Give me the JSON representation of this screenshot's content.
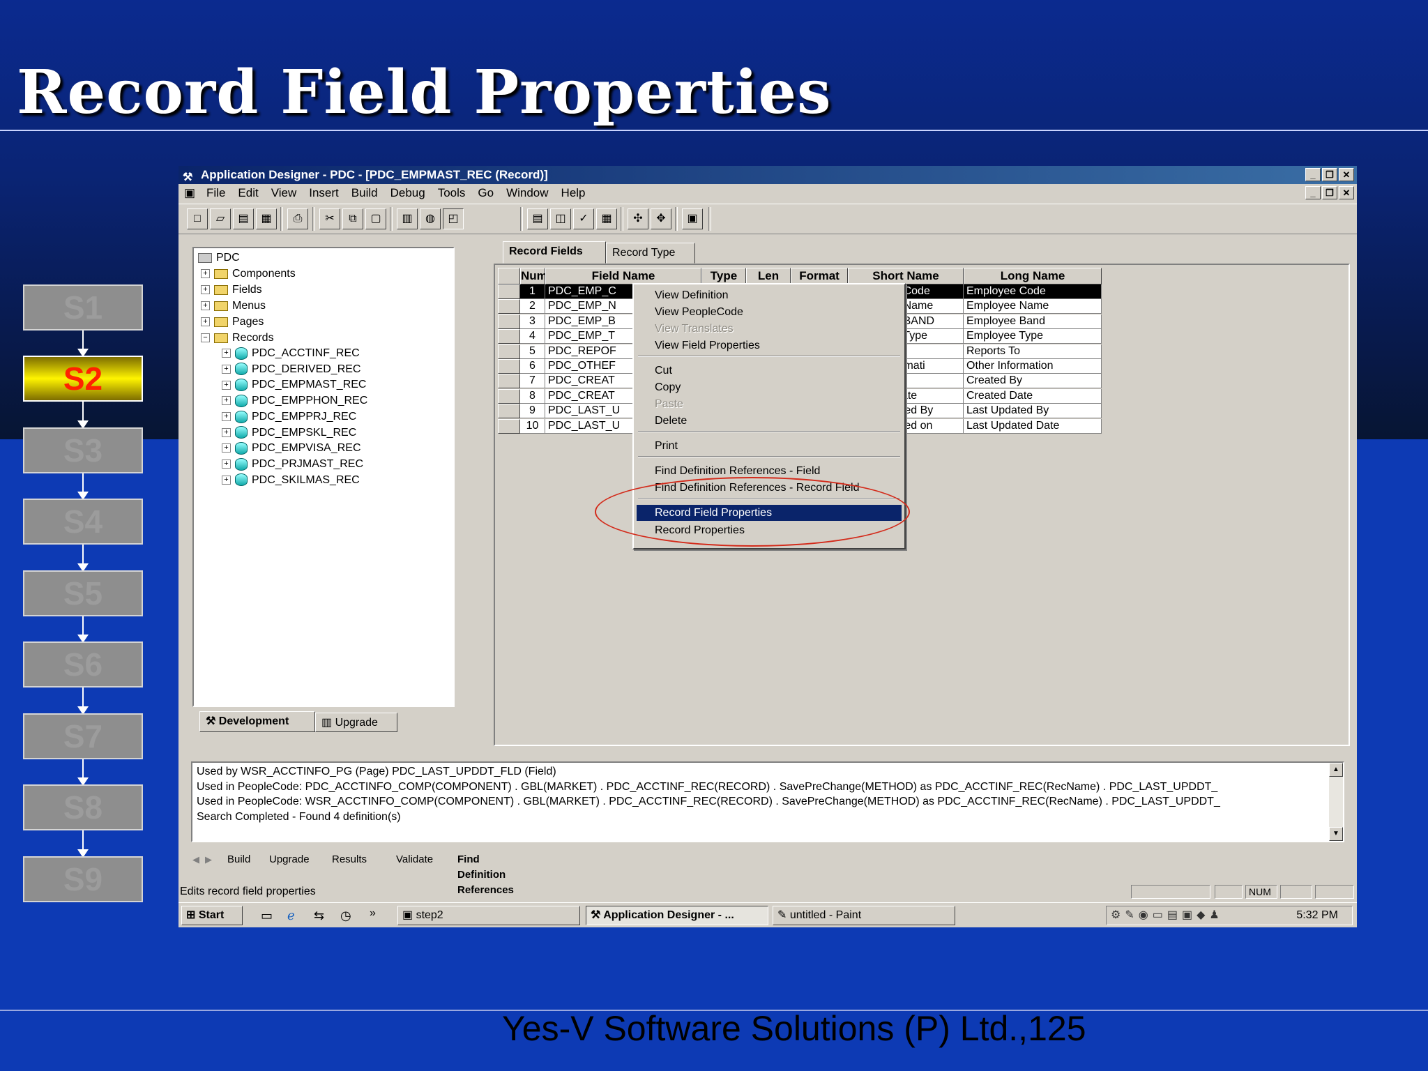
{
  "slide": {
    "title": "Record Field Properties",
    "footer": "Yes-V Software Solutions (P) Ltd.,125",
    "steps": [
      "S1",
      "S2",
      "S3",
      "S4",
      "S5",
      "S6",
      "S7",
      "S8",
      "S9"
    ],
    "active_step": "S2",
    "active_color": "#ff2200"
  },
  "window": {
    "title": "Application Designer - PDC - [PDC_EMPMAST_REC (Record)]",
    "menu": [
      "File",
      "Edit",
      "View",
      "Insert",
      "Build",
      "Debug",
      "Tools",
      "Go",
      "Window",
      "Help"
    ]
  },
  "tree": {
    "root": "PDC",
    "folders": [
      "Components",
      "Fields",
      "Menus",
      "Pages",
      "Records"
    ],
    "records": [
      "PDC_ACCTINF_REC",
      "PDC_DERIVED_REC",
      "PDC_EMPMAST_REC",
      "PDC_EMPPHON_REC",
      "PDC_EMPPRJ_REC",
      "PDC_EMPSKL_REC",
      "PDC_EMPVISA_REC",
      "PDC_PRJMAST_REC",
      "PDC_SKILMAS_REC"
    ],
    "tabs": [
      "Development",
      "Upgrade"
    ]
  },
  "record_tabs": [
    "Record Fields",
    "Record Type"
  ],
  "grid": {
    "headers": [
      "Num",
      "Field Name",
      "Type",
      "Len",
      "Format",
      "Short Name",
      "Long Name"
    ],
    "rows": [
      {
        "num": "1",
        "field": "PDC_EMP_C",
        "short": "Employee Code",
        "long": "Employee Code"
      },
      {
        "num": "2",
        "field": "PDC_EMP_N",
        "short": "Employee Name",
        "long": "Employee Name"
      },
      {
        "num": "3",
        "field": "PDC_EMP_B",
        "short": "Employee BAND",
        "long": "Employee Band"
      },
      {
        "num": "4",
        "field": "PDC_EMP_T",
        "short": "Employee Type",
        "long": "Employee Type"
      },
      {
        "num": "5",
        "field": "PDC_REPOF",
        "short": "Reports To",
        "long": "Reports To"
      },
      {
        "num": "6",
        "field": "PDC_OTHEF",
        "short": "Other Informati",
        "long": "Other Information"
      },
      {
        "num": "7",
        "field": "PDC_CREAT",
        "short": "Created By",
        "long": "Created By"
      },
      {
        "num": "8",
        "field": "PDC_CREAT",
        "short": "Created Date",
        "long": "Created Date"
      },
      {
        "num": "9",
        "field": "PDC_LAST_U",
        "short": "Last Updated By",
        "long": "Last Updated By"
      },
      {
        "num": "10",
        "field": "PDC_LAST_U",
        "short": "Last Updated on",
        "long": "Last Updated Date"
      }
    ]
  },
  "context_menu": {
    "items": [
      {
        "label": "View Definition",
        "disabled": false
      },
      {
        "label": "View PeopleCode",
        "disabled": false
      },
      {
        "label": "View Translates",
        "disabled": true
      },
      {
        "label": "View Field Properties",
        "disabled": false
      },
      {
        "label": "Cut",
        "disabled": false
      },
      {
        "label": "Copy",
        "disabled": false
      },
      {
        "label": "Paste",
        "disabled": true
      },
      {
        "label": "Delete",
        "disabled": false
      },
      {
        "label": "Print",
        "disabled": false
      },
      {
        "label": "Find Definition References - Field",
        "disabled": false
      },
      {
        "label": "Find Definition References - Record Field",
        "disabled": false
      },
      {
        "label": "Record Field Properties",
        "disabled": false,
        "highlighted": true
      },
      {
        "label": "Record Properties",
        "disabled": false
      }
    ]
  },
  "output": {
    "lines": [
      "Used by    WSR_ACCTINFO_PG (Page)    PDC_LAST_UPDDT_FLD (Field)",
      "Used in PeopleCode: PDC_ACCTINFO_COMP(COMPONENT) . GBL(MARKET) . PDC_ACCTINF_REC(RECORD) . SavePreChange(METHOD)  as  PDC_ACCTINF_REC(RecName) . PDC_LAST_UPDDT_",
      "Used in PeopleCode: WSR_ACCTINFO_COMP(COMPONENT) . GBL(MARKET) . PDC_ACCTINF_REC(RECORD) . SavePreChange(METHOD)  as  PDC_ACCTINF_REC(RecName) . PDC_LAST_UPDDT_",
      "Search Completed - Found 4 definition(s)"
    ],
    "tabs": [
      "Build",
      "Upgrade",
      "Results",
      "Validate",
      "Find Definition References"
    ]
  },
  "status": {
    "text": "Edits record field properties",
    "num": "NUM"
  },
  "taskbar": {
    "start": "Start",
    "tasks": [
      "step2",
      "Application Designer - ...",
      "untitled - Paint"
    ],
    "clock": "5:32 PM"
  }
}
